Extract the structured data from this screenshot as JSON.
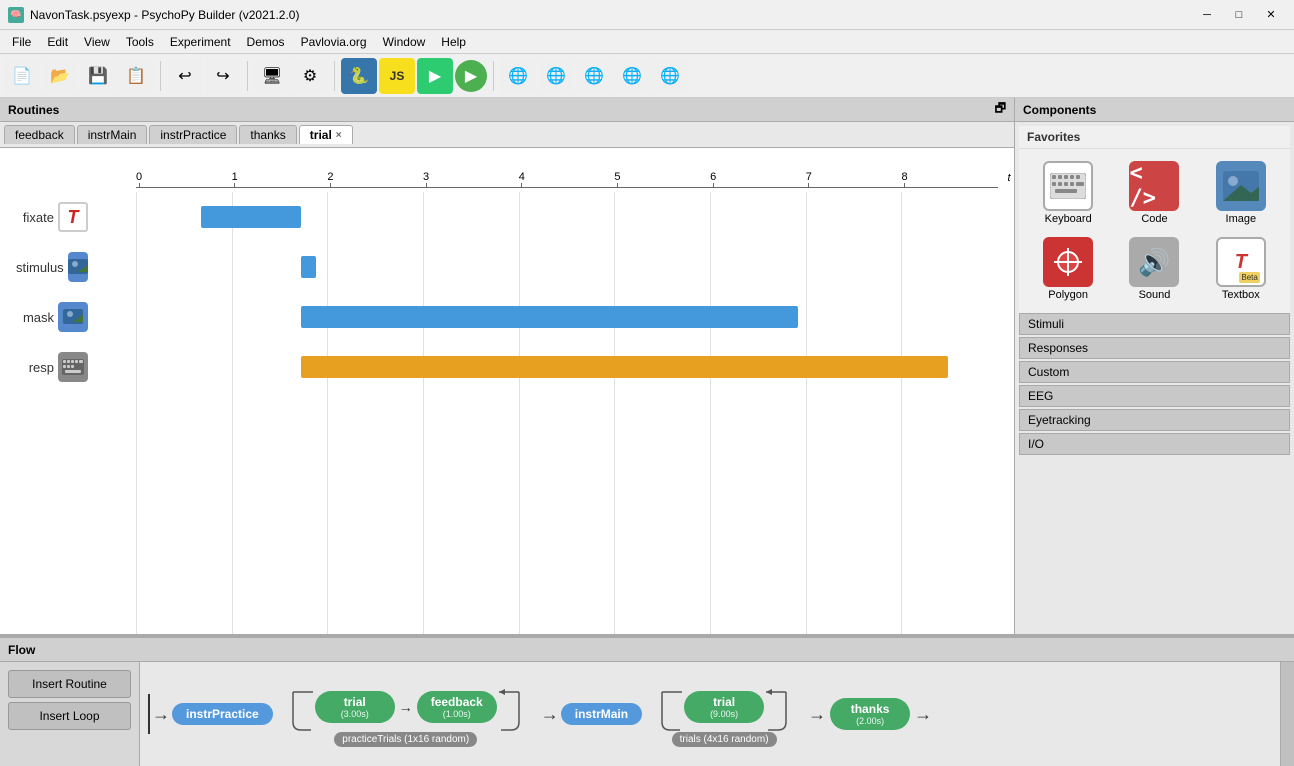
{
  "window": {
    "title": "NavonTask.psyexp - PsychoPy Builder (v2021.2.0)"
  },
  "titlebar": {
    "icon": "🧠",
    "title": "NavonTask.psyexp - PsychoPy Builder (v2021.2.0)",
    "minimize": "─",
    "maximize": "□",
    "close": "✕"
  },
  "menubar": {
    "items": [
      "File",
      "Edit",
      "View",
      "Tools",
      "Experiment",
      "Demos",
      "Pavlovia.org",
      "Window",
      "Help"
    ]
  },
  "routines": {
    "header": "Routines",
    "tabs": [
      {
        "label": "feedback",
        "active": false,
        "closable": false
      },
      {
        "label": "instrMain",
        "active": false,
        "closable": false
      },
      {
        "label": "instrPractice",
        "active": false,
        "closable": false
      },
      {
        "label": "thanks",
        "active": false,
        "closable": false
      },
      {
        "label": "trial",
        "active": true,
        "closable": true
      }
    ]
  },
  "timeline": {
    "axis_label": "t (sec)",
    "ticks": [
      0,
      1,
      2,
      3,
      4,
      5,
      6,
      7,
      8
    ],
    "rows": [
      {
        "name": "fixate",
        "icon_type": "text",
        "icon_label": "T",
        "bar_start": 1,
        "bar_end": 2,
        "bar_color": "blue"
      },
      {
        "name": "stimulus",
        "icon_type": "image",
        "icon_label": "🖼",
        "bar_start": 2,
        "bar_end": 2.15,
        "bar_color": "blue"
      },
      {
        "name": "mask",
        "icon_type": "image",
        "icon_label": "🖼",
        "bar_start": 2,
        "bar_end": 7,
        "bar_color": "blue"
      },
      {
        "name": "resp",
        "icon_type": "keyboard",
        "icon_label": "⌨",
        "bar_start": 2,
        "bar_end": 8.5,
        "bar_color": "orange"
      }
    ]
  },
  "components": {
    "header": "Components",
    "favorites_label": "Favorites",
    "favorites": [
      {
        "name": "Keyboard",
        "icon_type": "keyboard"
      },
      {
        "name": "Code",
        "icon_type": "code"
      },
      {
        "name": "Image",
        "icon_type": "image"
      },
      {
        "name": "Polygon",
        "icon_type": "polygon"
      },
      {
        "name": "Sound",
        "icon_type": "sound"
      },
      {
        "name": "Textbox",
        "icon_type": "textbox"
      }
    ],
    "sections": [
      {
        "label": "Stimuli"
      },
      {
        "label": "Responses"
      },
      {
        "label": "Custom"
      },
      {
        "label": "EEG"
      },
      {
        "label": "Eyetracking"
      },
      {
        "label": "I/O"
      }
    ]
  },
  "flow": {
    "header": "Flow",
    "insert_routine": "Insert Routine",
    "insert_loop": "Insert Loop",
    "nodes": [
      {
        "id": "instrPractice",
        "label": "instrPractice",
        "type": "blue"
      },
      {
        "id": "trial_practice",
        "label": "trial",
        "sub": "(3.00s)",
        "type": "green"
      },
      {
        "id": "feedback",
        "label": "feedback",
        "sub": "(1.00s)",
        "type": "green"
      },
      {
        "id": "instrMain",
        "label": "instrMain",
        "type": "blue"
      },
      {
        "id": "trial_main",
        "label": "trial",
        "sub": "(9.00s)",
        "type": "green"
      },
      {
        "id": "thanks",
        "label": "thanks",
        "sub": "(2.00s)",
        "type": "green"
      }
    ],
    "loops": [
      {
        "label": "practiceTrials (1x16 random)",
        "covers": [
          "trial_practice",
          "feedback"
        ]
      },
      {
        "label": "trials (4x16 random)",
        "covers": [
          "trial_main"
        ]
      }
    ]
  }
}
